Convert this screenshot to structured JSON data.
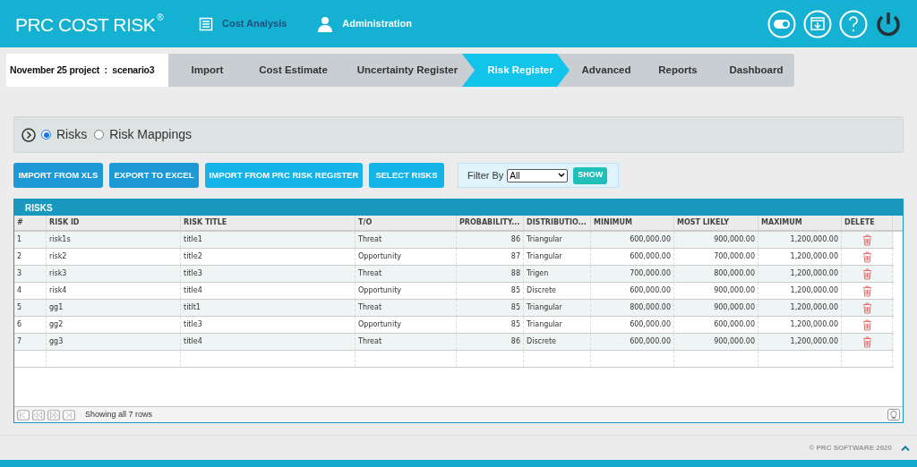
{
  "header": {
    "logo": "**PRC** COST RISK",
    "logo_mark": "®",
    "nav": [
      {
        "kind": "list",
        "label": "Cost Analysis"
      },
      {
        "kind": "user",
        "label": "Administration"
      }
    ]
  },
  "project_label": "November 25 project  :  scenario3",
  "steps": [
    {
      "label": "Import",
      "selected": false
    },
    {
      "label": "Cost Estimate",
      "selected": false
    },
    {
      "label": "Uncertainty Register",
      "selected": false
    },
    {
      "label": "Risk Register",
      "selected": true
    },
    {
      "label": "Advanced",
      "selected": false
    },
    {
      "label": "Reports",
      "selected": false
    },
    {
      "label": "Dashboard",
      "selected": false
    }
  ],
  "view_options": [
    {
      "label": "Risks",
      "selected": true
    },
    {
      "label": "Risk Mappings",
      "selected": false
    }
  ],
  "buttons": [
    "IMPORT FROM XLS",
    "EXPORT TO EXCEL",
    "IMPORT FROM PRC RISK REGISTER",
    "SELECT RISKS"
  ],
  "filter": {
    "label": "Filter By",
    "value": "All",
    "button": "SHOW"
  },
  "grid": {
    "title": "RISKS",
    "columns": [
      "#",
      "RISK ID",
      "RISK TITLE",
      "T/O",
      "PROBABILITY...",
      "DISTRIBUTIO...",
      "MINIMUM",
      "MOST LIKELY",
      "MAXIMUM",
      "DELETE"
    ],
    "rows": [
      [
        "1",
        "risk1s",
        "title1",
        "Threat",
        "86",
        "Triangular",
        "600,000.00",
        "900,000.00",
        "1,200,000.00"
      ],
      [
        "2",
        "risk2",
        "title2",
        "Opportunity",
        "87",
        "Triangular",
        "600,000.00",
        "700,000.00",
        "1,200,000.00"
      ],
      [
        "3",
        "risk3",
        "title3",
        "Threat",
        "88",
        "Trigen",
        "700,000.00",
        "800,000.00",
        "1,200,000.00"
      ],
      [
        "4",
        "risk4",
        "title4",
        "Opportunity",
        "85",
        "Discrete",
        "600,000.00",
        "900,000.00",
        "1,200,000.00"
      ],
      [
        "5",
        "gg1",
        "titlt1",
        "Threat",
        "85",
        "Triangular",
        "800,000.00",
        "900,000.00",
        "1,200,000.00"
      ],
      [
        "6",
        "gg2",
        "title3",
        "Opportunity",
        "85",
        "Triangular",
        "600,000.00",
        "600,000.00",
        "1,200,000.00"
      ],
      [
        "7",
        "gg3",
        "title4",
        "Threat",
        "86",
        "Discrete",
        "600,000.00",
        "900,000.00",
        "1,200,000.00"
      ]
    ]
  },
  "pager": {
    "text": "Showing all 7 rows"
  },
  "footer": {
    "copyright": "© PRC SOFTWARE 2020"
  }
}
